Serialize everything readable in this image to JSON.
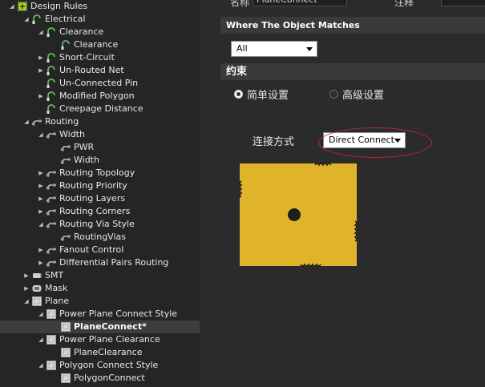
{
  "tree": {
    "items": [
      {
        "label": "Design Rules",
        "indent": 0,
        "arrow": "open",
        "icon": "design-rules-icon"
      },
      {
        "label": "Electrical",
        "indent": 1,
        "arrow": "open",
        "icon": "electrical-rule-icon"
      },
      {
        "label": "Clearance",
        "indent": 2,
        "arrow": "open",
        "icon": "clearance-rule-icon"
      },
      {
        "label": "Clearance",
        "indent": 3,
        "arrow": "none",
        "icon": "clearance-rule-icon"
      },
      {
        "label": "Short-Circuit",
        "indent": 2,
        "arrow": "closed",
        "icon": "clearance-rule-icon"
      },
      {
        "label": "Un-Routed Net",
        "indent": 2,
        "arrow": "closed",
        "icon": "clearance-rule-icon"
      },
      {
        "label": "Un-Connected Pin",
        "indent": 2,
        "arrow": "none",
        "icon": "clearance-rule-icon"
      },
      {
        "label": "Modified Polygon",
        "indent": 2,
        "arrow": "closed",
        "icon": "clearance-rule-icon"
      },
      {
        "label": "Creepage Distance",
        "indent": 2,
        "arrow": "none",
        "icon": "clearance-rule-icon"
      },
      {
        "label": "Routing",
        "indent": 1,
        "arrow": "open",
        "icon": "routing-rule-icon"
      },
      {
        "label": "Width",
        "indent": 2,
        "arrow": "open",
        "icon": "routing-rule-icon"
      },
      {
        "label": "PWR",
        "indent": 3,
        "arrow": "none",
        "icon": "routing-rule-icon"
      },
      {
        "label": "Width",
        "indent": 3,
        "arrow": "none",
        "icon": "routing-rule-icon"
      },
      {
        "label": "Routing Topology",
        "indent": 2,
        "arrow": "closed",
        "icon": "routing-rule-icon"
      },
      {
        "label": "Routing Priority",
        "indent": 2,
        "arrow": "closed",
        "icon": "routing-rule-icon"
      },
      {
        "label": "Routing Layers",
        "indent": 2,
        "arrow": "closed",
        "icon": "routing-rule-icon"
      },
      {
        "label": "Routing Corners",
        "indent": 2,
        "arrow": "closed",
        "icon": "routing-rule-icon"
      },
      {
        "label": "Routing Via Style",
        "indent": 2,
        "arrow": "open",
        "icon": "routing-rule-icon"
      },
      {
        "label": "RoutingVias",
        "indent": 3,
        "arrow": "none",
        "icon": "routing-rule-icon"
      },
      {
        "label": "Fanout Control",
        "indent": 2,
        "arrow": "closed",
        "icon": "routing-rule-icon"
      },
      {
        "label": "Differential Pairs Routing",
        "indent": 2,
        "arrow": "closed",
        "icon": "routing-rule-icon"
      },
      {
        "label": "SMT",
        "indent": 1,
        "arrow": "closed",
        "icon": "smt-rule-icon"
      },
      {
        "label": "Mask",
        "indent": 1,
        "arrow": "closed",
        "icon": "mask-rule-icon"
      },
      {
        "label": "Plane",
        "indent": 1,
        "arrow": "open",
        "icon": "plane-rule-icon"
      },
      {
        "label": "Power Plane Connect Style",
        "indent": 2,
        "arrow": "open",
        "icon": "plane-rule-icon"
      },
      {
        "label": "PlaneConnect*",
        "indent": 3,
        "arrow": "none",
        "icon": "plane-rule-icon",
        "selected": true
      },
      {
        "label": "Power Plane Clearance",
        "indent": 2,
        "arrow": "open",
        "icon": "plane-rule-icon"
      },
      {
        "label": "PlaneClearance",
        "indent": 3,
        "arrow": "none",
        "icon": "plane-rule-icon"
      },
      {
        "label": "Polygon Connect Style",
        "indent": 2,
        "arrow": "open",
        "icon": "plane-rule-icon"
      },
      {
        "label": "PolygonConnect",
        "indent": 3,
        "arrow": "none",
        "icon": "plane-rule-icon"
      }
    ]
  },
  "rule": {
    "name_label": "名称",
    "name_value": "PlaneConnect",
    "comment_label": "注释",
    "comment_value": ""
  },
  "match_section": {
    "header": "Where The Object Matches",
    "scope_value": "All"
  },
  "constraints": {
    "header": "约束",
    "radio_simple": "简单设置",
    "radio_advanced": "高级设置",
    "selected_mode": "simple",
    "connect_label": "连接方式",
    "connect_value": "Direct Connect"
  },
  "colors": {
    "pad_fill": "#e0b42a",
    "highlight": "#c0272d"
  }
}
